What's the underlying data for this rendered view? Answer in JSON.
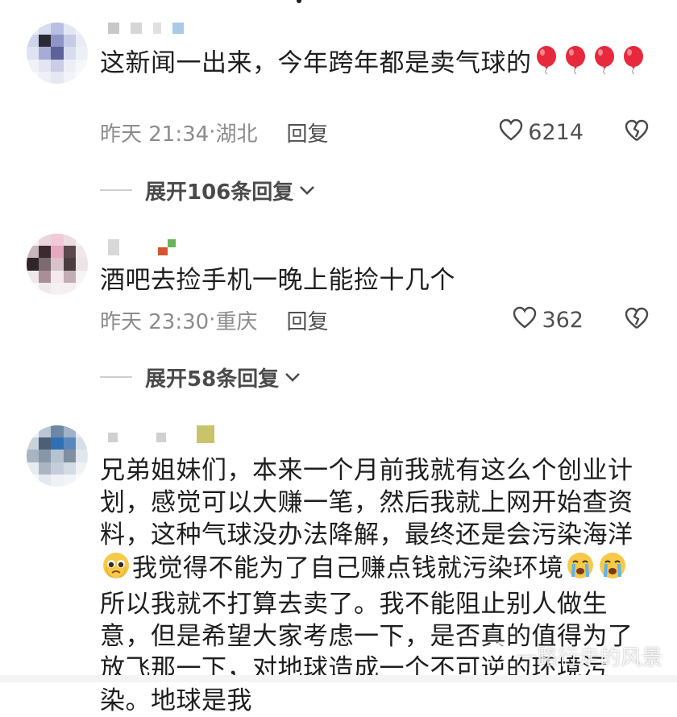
{
  "comments": [
    {
      "text": "这新闻一出来，今年跨年都是卖气球的",
      "balloon_count": 4,
      "time": "昨天 21:34",
      "location": "湖北",
      "reply_label": "回复",
      "likes": "6214",
      "expand_label": "展开106条回复"
    },
    {
      "text": "酒吧去捡手机一晚上能捡十几个",
      "time": "昨天 23:30",
      "location": "重庆",
      "reply_label": "回复",
      "likes": "362",
      "expand_label": "展开58条回复"
    },
    {
      "text_part1": "兄弟姐妹们，本来一个月前我就有这么个创业计划，感觉可以大赚一笔，然后我就上网开始查资料，这种气球没办法降解，最终还是会污染海洋",
      "text_part2": "我觉得不能为了自己赚点钱就污染环境",
      "text_part3": "所以我就不打算去卖了。我不能阻止别人做生意，但是希望大家考虑一下，是否真的值得为了放飞那一下，对地球造成一个不可逆的环境污染。地球是我"
    }
  ],
  "watermark": "一路行走的风景",
  "colors": {
    "balloon": "#e8283c",
    "emoji": "#f7c948",
    "meta": "#8c8c8c"
  }
}
